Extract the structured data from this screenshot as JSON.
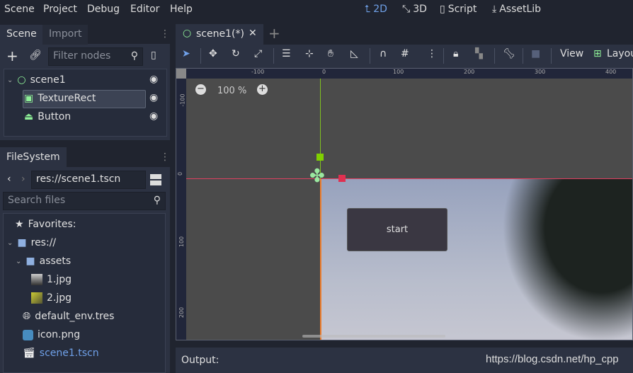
{
  "menubar": {
    "items": [
      "Scene",
      "Project",
      "Debug",
      "Editor",
      "Help"
    ]
  },
  "workspaces": [
    {
      "label": "2D",
      "icon": "2d-axes-icon",
      "active": true
    },
    {
      "label": "3D",
      "icon": "3d-axes-icon"
    },
    {
      "label": "Script",
      "icon": "script-icon"
    },
    {
      "label": "AssetLib",
      "icon": "download-icon"
    }
  ],
  "scene_dock": {
    "tabs": [
      "Scene",
      "Import"
    ],
    "filter_placeholder": "Filter nodes",
    "nodes": [
      {
        "name": "scene1",
        "icon": "node2d-circle-icon"
      },
      {
        "name": "TextureRect",
        "icon": "texture-rect-icon",
        "selected": true
      },
      {
        "name": "Button",
        "icon": "button-icon"
      }
    ]
  },
  "filesystem": {
    "tab": "FileSystem",
    "path": "res://scene1.tscn",
    "search_placeholder": "Search files",
    "favorites": "Favorites:",
    "root": "res://",
    "folder": "assets",
    "files": [
      "1.jpg",
      "2.jpg",
      "default_env.tres",
      "icon.png",
      "scene1.tscn"
    ]
  },
  "editor": {
    "tab": "scene1(*)",
    "view": "View",
    "layout": "Layout",
    "zoom": "100 %",
    "ruler_x": [
      "-100",
      "0",
      "100",
      "200",
      "300",
      "400"
    ],
    "ruler_y": [
      "-100",
      "0",
      "100",
      "200"
    ],
    "button_text": "start"
  },
  "output": {
    "label": "Output:",
    "watermark": "https://blog.csdn.net/hp_cpp"
  },
  "colors": {
    "accent": "#6fa0e8",
    "bg": "#20242f",
    "panel": "#2c3242",
    "canvas": "#4b4b4b",
    "x_axis": "#e04060",
    "y_axis": "#80c020"
  }
}
